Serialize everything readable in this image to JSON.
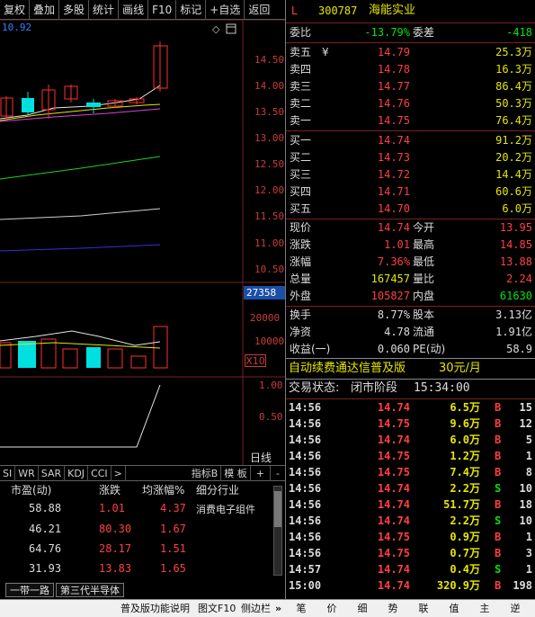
{
  "toolbar": {
    "items": [
      "复权",
      "叠加",
      "多股",
      "统计",
      "画线",
      "F10",
      "标记",
      "+自选",
      "返回"
    ]
  },
  "chart": {
    "top_left_value": "10.92",
    "price_ticks": [
      "14.50",
      "14.00",
      "13.50",
      "13.00",
      "12.50",
      "12.00",
      "11.50",
      "11.00",
      "10.50"
    ],
    "vol_box": "27358",
    "vol_ticks": [
      "20000",
      "10000"
    ],
    "vol_unit": "X10",
    "ind_ticks": [
      "1.00",
      "0.50"
    ],
    "ind_label": "日线"
  },
  "indicator_tabs": [
    "SI",
    "WR",
    "SAR",
    "KDJ",
    "CCI",
    ">",
    "指标B",
    "模 板",
    "+",
    "-"
  ],
  "sub_table": {
    "headers": [
      "市盈(动)",
      "涨跌",
      "均涨幅%",
      "细分行业"
    ],
    "rows": [
      {
        "pe": "58.88",
        "chg": "1.01",
        "avg": "4.37",
        "ind": "消费电子组件"
      },
      {
        "pe": "46.21",
        "chg": "80.30",
        "avg": "1.67",
        "ind": ""
      },
      {
        "pe": "64.76",
        "chg": "28.17",
        "avg": "1.51",
        "ind": ""
      },
      {
        "pe": "31.93",
        "chg": "13.83",
        "avg": "1.65",
        "ind": ""
      }
    ]
  },
  "bottom_tabs": [
    "一带一路",
    "第三代半导体"
  ],
  "stock": {
    "flag": "L",
    "code": "300787",
    "name": "海能实业"
  },
  "weibi": {
    "l1": "委比",
    "v1": "-13.79%",
    "l2": "委差",
    "v2": "-418"
  },
  "asks": [
    {
      "label": "卖五",
      "price": "14.79",
      "vol": "25.3万",
      "extra": "¥"
    },
    {
      "label": "卖四",
      "price": "14.78",
      "vol": "16.3万",
      "extra": ""
    },
    {
      "label": "卖三",
      "price": "14.77",
      "vol": "86.4万",
      "extra": ""
    },
    {
      "label": "卖二",
      "price": "14.76",
      "vol": "50.3万",
      "extra": ""
    },
    {
      "label": "卖一",
      "price": "14.75",
      "vol": "76.4万",
      "extra": ""
    }
  ],
  "bids": [
    {
      "label": "买一",
      "price": "14.74",
      "vol": "91.2万"
    },
    {
      "label": "买二",
      "price": "14.73",
      "vol": "20.2万"
    },
    {
      "label": "买三",
      "price": "14.72",
      "vol": "14.4万"
    },
    {
      "label": "买四",
      "price": "14.71",
      "vol": "60.6万"
    },
    {
      "label": "买五",
      "price": "14.70",
      "vol": "6.0万"
    }
  ],
  "quote": [
    {
      "l1": "现价",
      "v1": "14.74",
      "l2": "今开",
      "v2": "13.95",
      "c1": "#ff4040",
      "c2": "#ff4040"
    },
    {
      "l1": "涨跌",
      "v1": "1.01",
      "l2": "最高",
      "v2": "14.85",
      "c1": "#ff4040",
      "c2": "#ff4040"
    },
    {
      "l1": "涨幅",
      "v1": "7.36%",
      "l2": "最低",
      "v2": "13.88",
      "c1": "#ff4040",
      "c2": "#ff4040"
    },
    {
      "l1": "总量",
      "v1": "167457",
      "l2": "量比",
      "v2": "2.24",
      "c1": "#e6e600",
      "c2": "#ff4040"
    },
    {
      "l1": "外盘",
      "v1": "105827",
      "l2": "内盘",
      "v2": "61630",
      "c1": "#ff4040",
      "c2": "#00e600"
    }
  ],
  "fin": [
    {
      "l1": "换手",
      "v1": "8.77%",
      "l2": "股本",
      "v2": "3.13亿"
    },
    {
      "l1": "净资",
      "v1": "4.78",
      "l2": "流通",
      "v2": "1.91亿"
    },
    {
      "l1": "收益(一)",
      "v1": "0.060",
      "l2": "PE(动)",
      "v2": "58.9"
    }
  ],
  "promo": {
    "text": "自动续费通达信普及版",
    "price": "30元/月"
  },
  "trade_status": {
    "label": "交易状态:",
    "status": "闭市阶段",
    "time": "15:34:00"
  },
  "ticks": [
    {
      "t": "14:56",
      "p": "14.74",
      "v": "6.5万",
      "s": "B",
      "n": "15"
    },
    {
      "t": "14:56",
      "p": "14.75",
      "v": "9.6万",
      "s": "B",
      "n": "12"
    },
    {
      "t": "14:56",
      "p": "14.74",
      "v": "6.0万",
      "s": "B",
      "n": "5"
    },
    {
      "t": "14:56",
      "p": "14.75",
      "v": "1.2万",
      "s": "B",
      "n": "1"
    },
    {
      "t": "14:56",
      "p": "14.75",
      "v": "7.4万",
      "s": "B",
      "n": "8"
    },
    {
      "t": "14:56",
      "p": "14.74",
      "v": "2.2万",
      "s": "S",
      "n": "10"
    },
    {
      "t": "14:56",
      "p": "14.74",
      "v": "51.7万",
      "s": "B",
      "n": "18"
    },
    {
      "t": "14:56",
      "p": "14.74",
      "v": "2.2万",
      "s": "S",
      "n": "10"
    },
    {
      "t": "14:56",
      "p": "14.75",
      "v": "0.9万",
      "s": "B",
      "n": "1"
    },
    {
      "t": "14:56",
      "p": "14.75",
      "v": "0.7万",
      "s": "B",
      "n": "3"
    },
    {
      "t": "14:57",
      "p": "14.74",
      "v": "0.4万",
      "s": "S",
      "n": "1"
    },
    {
      "t": "15:00",
      "p": "14.74",
      "v": "320.9万",
      "s": "B",
      "n": "198"
    }
  ],
  "right_tabs": [
    "笔",
    "价",
    "细",
    "势",
    "联",
    "值",
    "主",
    "逆"
  ],
  "bottom_bar": {
    "items": [
      "普及版功能说明",
      "图文F10",
      "侧边栏"
    ],
    "arrows": "»"
  }
}
